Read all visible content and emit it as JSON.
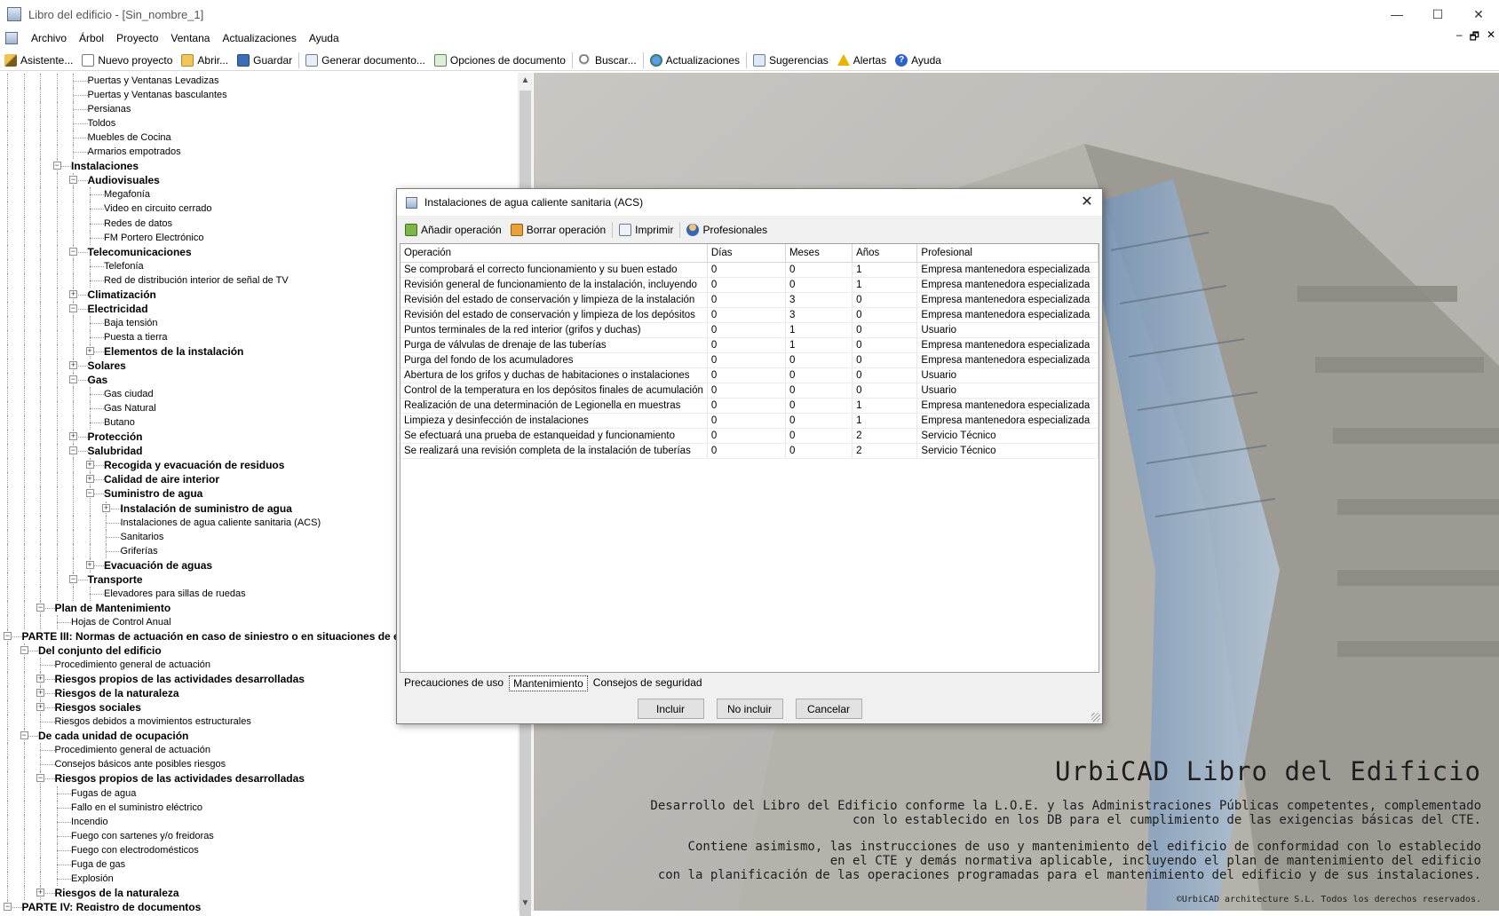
{
  "window": {
    "title": "Libro del edificio - [Sin_nombre_1]",
    "controls": [
      "—",
      "☐",
      "✕"
    ]
  },
  "menu": {
    "items": [
      "Archivo",
      "Árbol",
      "Proyecto",
      "Ventana",
      "Actualizaciones",
      "Ayuda"
    ],
    "mdi_controls": [
      "–",
      "🗗",
      "✕"
    ]
  },
  "toolbar": {
    "buttons": [
      {
        "label": "Asistente...",
        "icon": "wand-icon"
      },
      {
        "label": "Nuevo proyecto",
        "icon": "new-page-icon"
      },
      {
        "label": "Abrir...",
        "icon": "folder-icon"
      },
      {
        "label": "Guardar",
        "icon": "save-icon"
      },
      {
        "label": "Generar documento...",
        "icon": "document-icon"
      },
      {
        "label": "Opciones de documento",
        "icon": "document-options-icon"
      },
      {
        "label": "Buscar...",
        "icon": "search-icon"
      },
      {
        "label": "Actualizaciones",
        "icon": "globe-icon"
      },
      {
        "label": "Sugerencias",
        "icon": "suggestions-icon"
      },
      {
        "label": "Alertas",
        "icon": "warning-icon"
      },
      {
        "label": "Ayuda",
        "icon": "help-icon"
      }
    ]
  },
  "tree": {
    "rows": [
      {
        "label": "Puertas y Ventanas Levadizas",
        "level": 6,
        "bold": false,
        "exp": ""
      },
      {
        "label": "Puertas y Ventanas basculantes",
        "level": 6,
        "bold": false,
        "exp": ""
      },
      {
        "label": "Persianas",
        "level": 6,
        "bold": false,
        "exp": ""
      },
      {
        "label": "Toldos",
        "level": 6,
        "bold": false,
        "exp": ""
      },
      {
        "label": "Muebles de Cocina",
        "level": 6,
        "bold": false,
        "exp": ""
      },
      {
        "label": "Armarios empotrados",
        "level": 6,
        "bold": false,
        "exp": ""
      },
      {
        "label": "Instalaciones",
        "level": 5,
        "bold": true,
        "exp": "-"
      },
      {
        "label": "Audiovisuales",
        "level": 6,
        "bold": true,
        "exp": "-"
      },
      {
        "label": "Megafonía",
        "level": 7,
        "bold": false,
        "exp": ""
      },
      {
        "label": "Video en circuito cerrado",
        "level": 7,
        "bold": false,
        "exp": ""
      },
      {
        "label": "Redes de datos",
        "level": 7,
        "bold": false,
        "exp": ""
      },
      {
        "label": "FM   Portero Electrónico",
        "level": 7,
        "bold": false,
        "exp": ""
      },
      {
        "label": "Telecomunicaciones",
        "level": 6,
        "bold": true,
        "exp": "-"
      },
      {
        "label": "Telefonía",
        "level": 7,
        "bold": false,
        "exp": ""
      },
      {
        "label": "Red de distribución interior de señal de TV",
        "level": 7,
        "bold": false,
        "exp": ""
      },
      {
        "label": "Climatización",
        "level": 6,
        "bold": true,
        "exp": "+"
      },
      {
        "label": "Electricidad",
        "level": 6,
        "bold": true,
        "exp": "-"
      },
      {
        "label": "Baja tensión",
        "level": 7,
        "bold": false,
        "exp": ""
      },
      {
        "label": "Puesta a tierra",
        "level": 7,
        "bold": false,
        "exp": ""
      },
      {
        "label": "Elementos de la instalación",
        "level": 7,
        "bold": true,
        "exp": "+"
      },
      {
        "label": "Solares",
        "level": 6,
        "bold": true,
        "exp": "+"
      },
      {
        "label": "Gas",
        "level": 6,
        "bold": true,
        "exp": "-"
      },
      {
        "label": "Gas ciudad",
        "level": 7,
        "bold": false,
        "exp": ""
      },
      {
        "label": "Gas Natural",
        "level": 7,
        "bold": false,
        "exp": ""
      },
      {
        "label": "Butano",
        "level": 7,
        "bold": false,
        "exp": ""
      },
      {
        "label": "Protección",
        "level": 6,
        "bold": true,
        "exp": "+"
      },
      {
        "label": "Salubridad",
        "level": 6,
        "bold": true,
        "exp": "-"
      },
      {
        "label": "Recogida y evacuación de residuos",
        "level": 7,
        "bold": true,
        "exp": "+"
      },
      {
        "label": "Calidad de aire interior",
        "level": 7,
        "bold": true,
        "exp": "+"
      },
      {
        "label": "Suministro de agua",
        "level": 7,
        "bold": true,
        "exp": "-"
      },
      {
        "label": "Instalación de suministro de agua",
        "level": 8,
        "bold": true,
        "exp": "+"
      },
      {
        "label": "Instalaciones de agua caliente sanitaria (ACS)",
        "level": 8,
        "bold": false,
        "exp": ""
      },
      {
        "label": "Sanitarios",
        "level": 8,
        "bold": false,
        "exp": ""
      },
      {
        "label": "Griferías",
        "level": 8,
        "bold": false,
        "exp": ""
      },
      {
        "label": "Evacuación de aguas",
        "level": 7,
        "bold": true,
        "exp": "+"
      },
      {
        "label": "Transporte",
        "level": 6,
        "bold": true,
        "exp": "-"
      },
      {
        "label": "Elevadores para sillas de ruedas",
        "level": 7,
        "bold": false,
        "exp": ""
      },
      {
        "label": "Plan de Mantenimiento",
        "level": 4,
        "bold": true,
        "exp": "-"
      },
      {
        "label": "Hojas de Control Anual",
        "level": 5,
        "bold": false,
        "exp": ""
      },
      {
        "label": "PARTE III: Normas de actuación en caso de siniestro o en situaciones de emergencia",
        "level": 2,
        "bold": true,
        "exp": "-"
      },
      {
        "label": "Del conjunto del edificio",
        "level": 3,
        "bold": true,
        "exp": "-"
      },
      {
        "label": "Procedimiento general de actuación",
        "level": 4,
        "bold": false,
        "exp": ""
      },
      {
        "label": "Riesgos propios de las actividades desarrolladas",
        "level": 4,
        "bold": true,
        "exp": "+"
      },
      {
        "label": "Riesgos de la naturaleza",
        "level": 4,
        "bold": true,
        "exp": "+"
      },
      {
        "label": "Riesgos sociales",
        "level": 4,
        "bold": true,
        "exp": "+"
      },
      {
        "label": "Riesgos debidos a movimientos estructurales",
        "level": 4,
        "bold": false,
        "exp": ""
      },
      {
        "label": "De cada unidad de ocupación",
        "level": 3,
        "bold": true,
        "exp": "-"
      },
      {
        "label": "Procedimiento general de actuación",
        "level": 4,
        "bold": false,
        "exp": ""
      },
      {
        "label": "Consejos básicos ante  posibles riesgos",
        "level": 4,
        "bold": false,
        "exp": ""
      },
      {
        "label": "Riesgos propios de las actividades desarrolladas",
        "level": 4,
        "bold": true,
        "exp": "-"
      },
      {
        "label": "Fugas de agua",
        "level": 5,
        "bold": false,
        "exp": ""
      },
      {
        "label": "Fallo en el suministro eléctrico",
        "level": 5,
        "bold": false,
        "exp": ""
      },
      {
        "label": "Incendio",
        "level": 5,
        "bold": false,
        "exp": ""
      },
      {
        "label": "Fuego con sartenes y/o freidoras",
        "level": 5,
        "bold": false,
        "exp": ""
      },
      {
        "label": "Fuego con electrodomésticos",
        "level": 5,
        "bold": false,
        "exp": ""
      },
      {
        "label": "Fuga de gas",
        "level": 5,
        "bold": false,
        "exp": ""
      },
      {
        "label": "Explosión",
        "level": 5,
        "bold": false,
        "exp": ""
      },
      {
        "label": "Riesgos de la naturaleza",
        "level": 4,
        "bold": true,
        "exp": "+"
      },
      {
        "label": "PARTE IV: Registro de documentos",
        "level": 2,
        "bold": true,
        "exp": "-"
      }
    ],
    "scroll_up": "▲",
    "scroll_down": "▼"
  },
  "background": {
    "title": "UrbiCAD Libro del Edificio",
    "para1_line1": "Desarrollo del Libro del Edificio conforme la L.O.E. y las Administraciones Públicas competentes, complementado",
    "para1_line2": "con lo establecido en los DB para el cumplimiento de las exigencias básicas del CTE.",
    "para2_line1": "Contiene asimismo, las instrucciones de uso y mantenimiento del edificio de conformidad con lo establecido",
    "para2_line2": "en el CTE y demás normativa aplicable, incluyendo el plan de mantenimiento del edificio",
    "para2_line3": "con la planificación de las operaciones programadas para el mantenimiento del edificio y de sus instalaciones.",
    "copyright": "©UrbiCAD architecture S.L. Todos los derechos reservados."
  },
  "dialog": {
    "title": "Instalaciones de agua caliente sanitaria (ACS)",
    "close": "✕",
    "toolbar": {
      "add": "Añadir operación",
      "delete": "Borrar operación",
      "print": "Imprimir",
      "professionals": "Profesionales"
    },
    "columns": [
      "Operación",
      "Días",
      "Meses",
      "Años",
      "Profesional"
    ],
    "rows": [
      [
        "Se comprobará el correcto funcionamiento y su buen estado",
        "0",
        "0",
        "1",
        "Empresa mantenedora especializada"
      ],
      [
        "Revisión general de funcionamiento de la instalación, incluyendo",
        "0",
        "0",
        "1",
        "Empresa mantenedora especializada"
      ],
      [
        "Revisión del estado de conservación y limpieza de la instalación",
        "0",
        "3",
        "0",
        "Empresa mantenedora especializada"
      ],
      [
        "Revisión del estado de conservación y limpieza de los depósitos",
        "0",
        "3",
        "0",
        "Empresa mantenedora especializada"
      ],
      [
        "Puntos terminales de la red interior (grifos y duchas)",
        "0",
        "1",
        "0",
        "Usuario"
      ],
      [
        "Purga de válvulas de drenaje de las tuberías",
        "0",
        "1",
        "0",
        "Empresa mantenedora especializada"
      ],
      [
        "Purga del fondo de los acumuladores",
        "0",
        "0",
        "0",
        "Empresa mantenedora especializada"
      ],
      [
        "Abertura de los grifos y duchas de habitaciones o instalaciones",
        "0",
        "0",
        "0",
        "Usuario"
      ],
      [
        "Control de la temperatura en los depósitos finales de acumulación",
        "0",
        "0",
        "0",
        "Usuario"
      ],
      [
        "Realización de una determinación de Legionella en muestras",
        "0",
        "0",
        "1",
        "Empresa mantenedora especializada"
      ],
      [
        "Limpieza y desinfección de instalaciones",
        "0",
        "0",
        "1",
        "Empresa mantenedora especializada"
      ],
      [
        "Se efectuará una prueba de estanqueidad y funcionamiento",
        "0",
        "0",
        "2",
        "Servicio Técnico"
      ],
      [
        "Se realizará una revisión completa de la instalación de tuberías",
        "0",
        "0",
        "2",
        "Servicio Técnico"
      ]
    ],
    "tabs": [
      "Precauciones de uso",
      "Mantenimiento",
      "Consejos de seguridad"
    ],
    "active_tab": 1,
    "buttons": {
      "include": "Incluir",
      "exclude": "No incluir",
      "cancel": "Cancelar"
    }
  }
}
